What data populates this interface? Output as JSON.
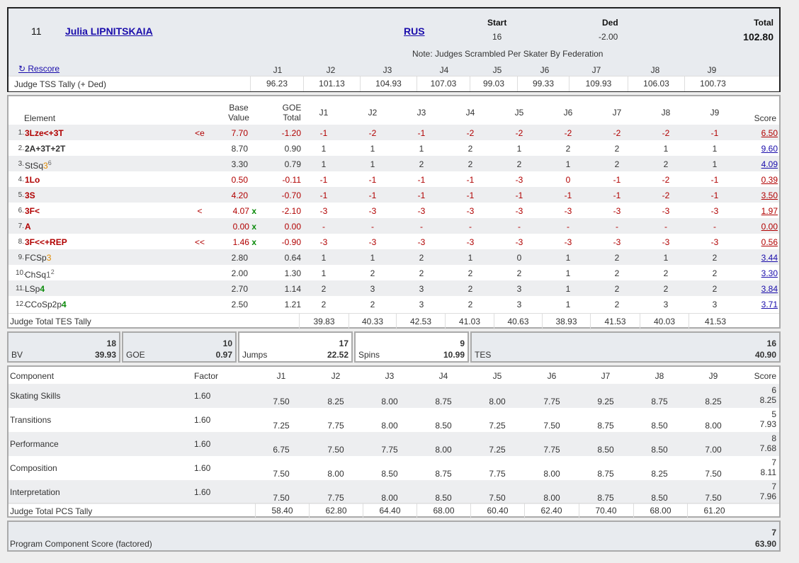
{
  "skater": {
    "rank": "11",
    "name": "Julia LIPNITSKAIA",
    "nation": "RUS"
  },
  "summary": {
    "start_label": "Start",
    "start_value": "16",
    "ded_label": "Ded",
    "ded_value": "-2.00",
    "total_label": "Total",
    "total_value": "102.80",
    "note": "Note: Judges Scrambled Per Skater By Federation"
  },
  "rescore_label": "Rescore",
  "judges": [
    "J1",
    "J2",
    "J3",
    "J4",
    "J5",
    "J6",
    "J7",
    "J8",
    "J9"
  ],
  "tss_tally": {
    "label": "Judge TSS Tally (+ Ded)",
    "values": [
      "96.23",
      "101.13",
      "104.93",
      "107.03",
      "99.03",
      "99.33",
      "109.93",
      "106.03",
      "100.73"
    ]
  },
  "elements_header": {
    "element": "Element",
    "base_value": [
      "Base",
      "Value"
    ],
    "goe_total": [
      "GOE",
      "Total"
    ],
    "score": "Score"
  },
  "elements": [
    {
      "num": "1.",
      "name": "3Lze<+3T",
      "sup": "",
      "lvl": "",
      "red": true,
      "info": "<e",
      "bv": "7.70",
      "x": "",
      "goe": "-1.20",
      "j": [
        "-1",
        "-2",
        "-1",
        "-2",
        "-2",
        "-2",
        "-2",
        "-2",
        "-1"
      ],
      "score": "6.50"
    },
    {
      "num": "2.",
      "name": "2A+3T+2T",
      "sup": "",
      "lvl": "",
      "red": false,
      "info": "",
      "bv": "8.70",
      "x": "",
      "goe": "0.90",
      "j": [
        "1",
        "1",
        "1",
        "2",
        "1",
        "2",
        "2",
        "1",
        "1"
      ],
      "score": "9.60"
    },
    {
      "num": "3.",
      "name": "StSq",
      "sup": "6",
      "lvl": "3",
      "lvlc": "o",
      "red": false,
      "plain": true,
      "info": "",
      "bv": "3.30",
      "x": "",
      "goe": "0.79",
      "j": [
        "1",
        "1",
        "2",
        "2",
        "2",
        "1",
        "2",
        "2",
        "1"
      ],
      "score": "4.09"
    },
    {
      "num": "4.",
      "name": "1Lo",
      "sup": "",
      "lvl": "",
      "red": true,
      "info": "",
      "bv": "0.50",
      "x": "",
      "goe": "-0.11",
      "j": [
        "-1",
        "-1",
        "-1",
        "-1",
        "-3",
        "0",
        "-1",
        "-2",
        "-1"
      ],
      "score": "0.39"
    },
    {
      "num": "5.",
      "name": "3S",
      "sup": "",
      "lvl": "",
      "red": true,
      "info": "",
      "bv": "4.20",
      "x": "",
      "goe": "-0.70",
      "j": [
        "-1",
        "-1",
        "-1",
        "-1",
        "-1",
        "-1",
        "-1",
        "-2",
        "-1"
      ],
      "score": "3.50"
    },
    {
      "num": "6.",
      "name": "3F<",
      "sup": "",
      "lvl": "",
      "red": true,
      "info": "<",
      "bv": "4.07",
      "x": "x",
      "goe": "-2.10",
      "j": [
        "-3",
        "-3",
        "-3",
        "-3",
        "-3",
        "-3",
        "-3",
        "-3",
        "-3"
      ],
      "score": "1.97"
    },
    {
      "num": "7.",
      "name": "A",
      "sup": "",
      "lvl": "",
      "red": true,
      "info": "",
      "bv": "0.00",
      "x": "x",
      "goe": "0.00",
      "j": [
        "-",
        "-",
        "-",
        "-",
        "-",
        "-",
        "-",
        "-",
        "-"
      ],
      "score": "0.00"
    },
    {
      "num": "8.",
      "name": "3F<<+REP",
      "sup": "",
      "lvl": "",
      "red": true,
      "info": "<<",
      "bv": "1.46",
      "x": "x",
      "goe": "-0.90",
      "j": [
        "-3",
        "-3",
        "-3",
        "-3",
        "-3",
        "-3",
        "-3",
        "-3",
        "-3"
      ],
      "score": "0.56"
    },
    {
      "num": "9.",
      "name": "FCSp",
      "sup": "",
      "lvl": "3",
      "lvlc": "o",
      "red": false,
      "plain": true,
      "info": "",
      "bv": "2.80",
      "x": "",
      "goe": "0.64",
      "j": [
        "1",
        "1",
        "2",
        "1",
        "0",
        "1",
        "2",
        "1",
        "2"
      ],
      "score": "3.44"
    },
    {
      "num": "10.",
      "name": "ChSq",
      "sup": "2",
      "lvl": "1",
      "lvlc": "gr",
      "red": false,
      "plain": true,
      "info": "",
      "bv": "2.00",
      "x": "",
      "goe": "1.30",
      "j": [
        "1",
        "2",
        "2",
        "2",
        "2",
        "1",
        "2",
        "2",
        "2"
      ],
      "score": "3.30"
    },
    {
      "num": "11.",
      "name": "LSp",
      "sup": "",
      "lvl": "4",
      "lvlc": "g",
      "red": false,
      "plain": true,
      "info": "",
      "bv": "2.70",
      "x": "",
      "goe": "1.14",
      "j": [
        "2",
        "3",
        "3",
        "2",
        "3",
        "1",
        "2",
        "2",
        "2"
      ],
      "score": "3.84"
    },
    {
      "num": "12.",
      "name": "CCoSp2p",
      "sup": "",
      "lvl": "4",
      "lvlc": "g",
      "red": false,
      "plain": true,
      "info": "",
      "bv": "2.50",
      "x": "",
      "goe": "1.21",
      "j": [
        "2",
        "2",
        "3",
        "2",
        "3",
        "1",
        "2",
        "3",
        "3"
      ],
      "score": "3.71"
    }
  ],
  "tes_tally": {
    "label": "Judge Total TES Tally",
    "values": [
      "39.83",
      "40.33",
      "42.53",
      "41.03",
      "40.63",
      "38.93",
      "41.53",
      "40.03",
      "41.53"
    ]
  },
  "totals": [
    {
      "label": "BV",
      "count": "18",
      "value": "39.93"
    },
    {
      "label": "GOE",
      "count": "10",
      "value": "0.97"
    },
    {
      "label": "Jumps",
      "count": "17",
      "value": "22.52"
    },
    {
      "label": "Spins",
      "count": "9",
      "value": "10.99"
    },
    {
      "label": "TES",
      "count": "16",
      "value": "40.90"
    }
  ],
  "components_header": {
    "component": "Component",
    "factor": "Factor",
    "score": "Score"
  },
  "components": [
    {
      "name": "Skating Skills",
      "factor": "1.60",
      "j": [
        "7.50",
        "8.25",
        "8.00",
        "8.75",
        "8.00",
        "7.75",
        "9.25",
        "8.75",
        "8.25"
      ],
      "rank": "6",
      "score": "8.25"
    },
    {
      "name": "Transitions",
      "factor": "1.60",
      "j": [
        "7.25",
        "7.75",
        "8.00",
        "8.50",
        "7.25",
        "7.50",
        "8.75",
        "8.50",
        "8.00"
      ],
      "rank": "5",
      "score": "7.93"
    },
    {
      "name": "Performance",
      "factor": "1.60",
      "j": [
        "6.75",
        "7.50",
        "7.75",
        "8.00",
        "7.25",
        "7.75",
        "8.50",
        "8.50",
        "7.00"
      ],
      "rank": "8",
      "score": "7.68"
    },
    {
      "name": "Composition",
      "factor": "1.60",
      "j": [
        "7.50",
        "8.00",
        "8.50",
        "8.75",
        "7.75",
        "8.00",
        "8.75",
        "8.25",
        "7.50"
      ],
      "rank": "7",
      "score": "8.11"
    },
    {
      "name": "Interpretation",
      "factor": "1.60",
      "j": [
        "7.50",
        "7.75",
        "8.00",
        "8.50",
        "7.50",
        "8.00",
        "8.75",
        "8.50",
        "7.50"
      ],
      "rank": "7",
      "score": "7.96"
    }
  ],
  "pcs_tally": {
    "label": "Judge Total PCS Tally",
    "values": [
      "58.40",
      "62.80",
      "64.40",
      "68.00",
      "60.40",
      "62.40",
      "70.40",
      "68.00",
      "61.20"
    ]
  },
  "pcs_total": {
    "label": "Program Component Score (factored)",
    "rank": "7",
    "value": "63.90"
  }
}
